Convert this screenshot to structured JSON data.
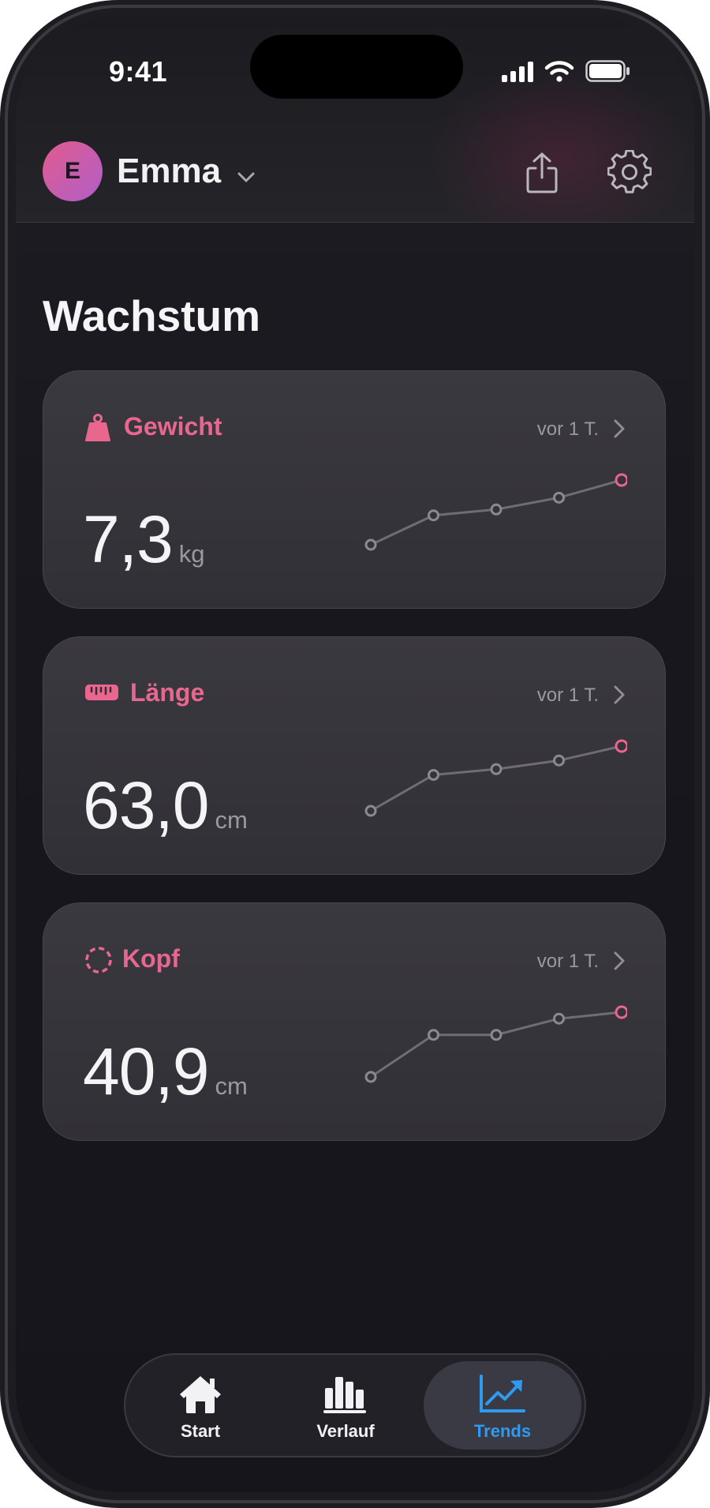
{
  "status_bar": {
    "time": "9:41",
    "icons": [
      "cellular-signal-icon",
      "wifi-icon",
      "battery-icon"
    ]
  },
  "header": {
    "avatar_initial": "E",
    "user_name": "Emma",
    "user_menu_icon": "chevron-down-icon",
    "actions": [
      "share-icon",
      "gear-icon"
    ]
  },
  "page": {
    "title": "Wachstum"
  },
  "metrics": [
    {
      "icon": "weight-icon",
      "title": "Gewicht",
      "updated": "vor 1 T.",
      "value": "7,3",
      "unit": "kg",
      "trend": [
        5.6,
        6.1,
        6.2,
        6.4,
        6.7
      ]
    },
    {
      "icon": "ruler-icon",
      "title": "Länge",
      "updated": "vor 1 T.",
      "value": "63,0",
      "unit": "cm",
      "trend": [
        56.5,
        59.0,
        59.4,
        60.0,
        61.0
      ]
    },
    {
      "icon": "head-circumference-icon",
      "title": "Kopf",
      "updated": "vor 1 T.",
      "value": "40,9",
      "unit": "cm",
      "trend": [
        37.5,
        38.8,
        38.8,
        39.3,
        39.5
      ]
    }
  ],
  "tab_bar": {
    "tabs": [
      {
        "label": "Start",
        "icon": "home-icon",
        "active": false
      },
      {
        "label": "Verlauf",
        "icon": "bar-chart-icon",
        "active": false
      },
      {
        "label": "Trends",
        "icon": "trend-line-icon",
        "active": true
      }
    ]
  },
  "colors": {
    "accent_pink": "#E9668F",
    "active_tab_blue": "#2F9BF0",
    "trend_line": "#6E6D73"
  }
}
